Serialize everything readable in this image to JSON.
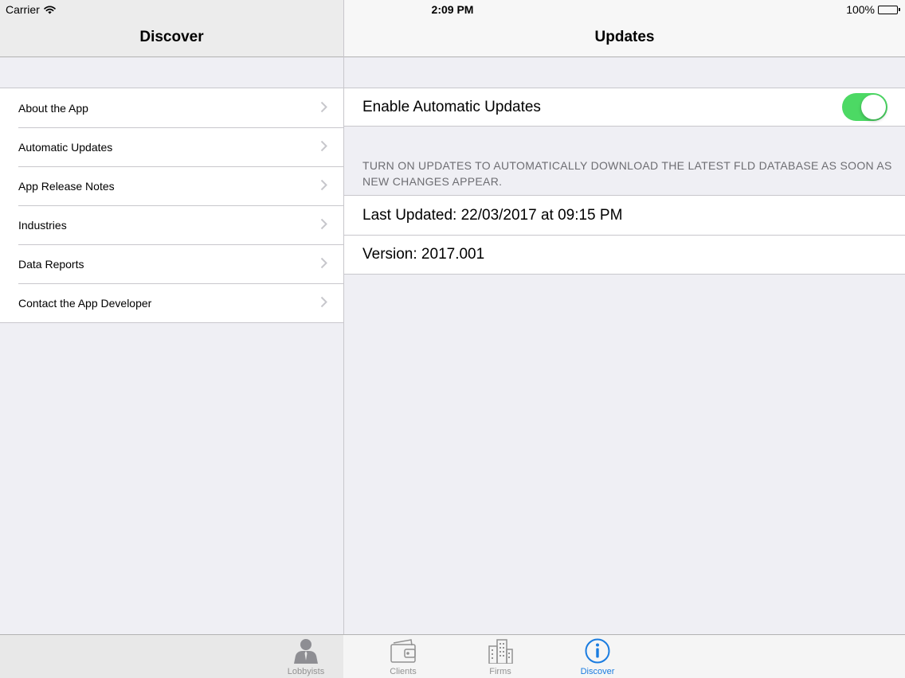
{
  "status_bar": {
    "carrier": "Carrier",
    "time": "2:09 PM",
    "battery": "100%"
  },
  "master": {
    "title": "Discover",
    "items": [
      {
        "label": "About the App"
      },
      {
        "label": "Automatic Updates"
      },
      {
        "label": "App Release Notes"
      },
      {
        "label": "Industries"
      },
      {
        "label": "Data Reports"
      },
      {
        "label": "Contact the App Developer"
      }
    ]
  },
  "detail": {
    "title": "Updates",
    "toggle": {
      "label": "Enable Automatic Updates",
      "on": true,
      "color": "#4cd964"
    },
    "footer_note": "TURN ON UPDATES TO AUTOMATICALLY DOWNLOAD THE LATEST FLD DATABASE AS SOON AS NEW CHANGES APPEAR.",
    "last_updated": "Last Updated: 22/03/2017 at 09:15 PM",
    "version": "Version: 2017.001"
  },
  "tabbar": {
    "tabs": [
      {
        "label": "Lobbyists",
        "icon": "person-icon"
      },
      {
        "label": "Clients",
        "icon": "wallet-icon"
      },
      {
        "label": "Firms",
        "icon": "building-icon"
      },
      {
        "label": "Discover",
        "icon": "info-icon",
        "selected": true
      }
    ],
    "accent": "#1a7ce0"
  }
}
